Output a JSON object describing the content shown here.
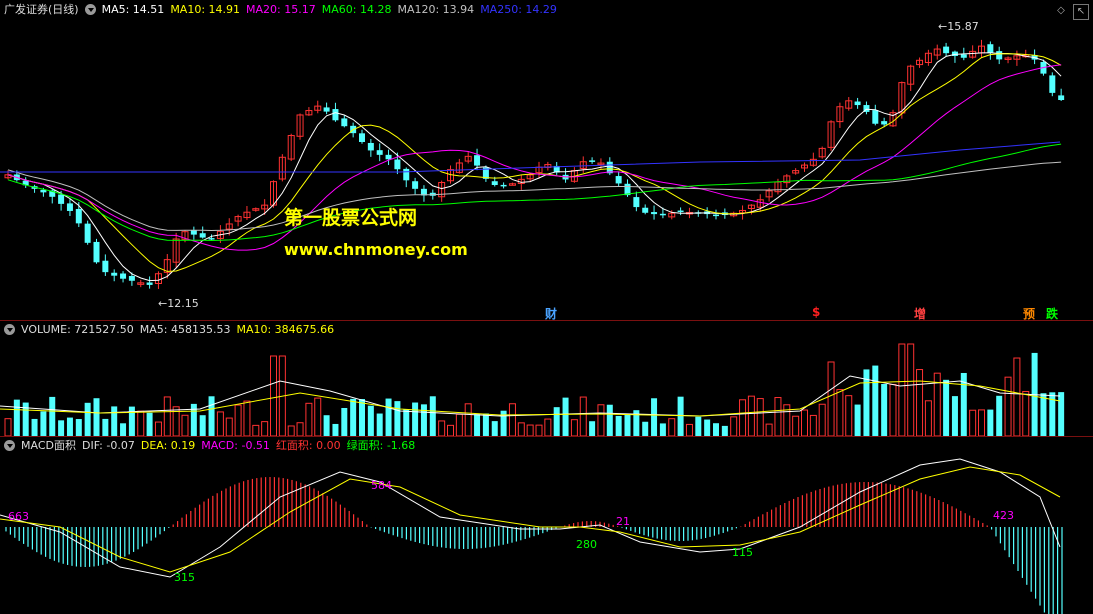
{
  "price_panel": {
    "title": "广发证券(日线)",
    "ma": [
      {
        "label": "MA5: 14.51",
        "color": "#ffffff"
      },
      {
        "label": "MA10: 14.91",
        "color": "#ffff00"
      },
      {
        "label": "MA20: 15.17",
        "color": "#ff00ff"
      },
      {
        "label": "MA60: 14.28",
        "color": "#00ff00"
      },
      {
        "label": "MA120: 13.94",
        "color": "#c0c0c0"
      },
      {
        "label": "MA250: 14.29",
        "color": "#3333ff"
      }
    ],
    "high_label": "15.87",
    "low_label": "12.15",
    "events": [
      {
        "text": "财",
        "color": "#4aa3ff"
      },
      {
        "text": "$",
        "color": "#ff2020"
      },
      {
        "text": "增",
        "color": "#ff4040"
      },
      {
        "text": "预",
        "color": "#ff8800"
      },
      {
        "text": "跌",
        "color": "#00ff00"
      }
    ],
    "watermark_title": "第一股票公式网",
    "watermark_url": "www.chnmoney.com"
  },
  "volume_panel": {
    "title": "VOLUME: 721527.50",
    "ma5": "MA5: 458135.53",
    "ma10": "MA10: 384675.66"
  },
  "macd_panel": {
    "title": "MACD面积",
    "dif": "DIF: -0.07",
    "dea": "DEA: 0.19",
    "macd": "MACD: -0.51",
    "red_area": "红面积: 0.00",
    "green_area": "绿面积: -1.68",
    "area_labels": [
      "663",
      "315",
      "584",
      "280",
      "21",
      "115",
      "423"
    ]
  },
  "colors": {
    "up": "#ff3232",
    "down": "#54ffff",
    "separator": "#7a1010"
  }
}
